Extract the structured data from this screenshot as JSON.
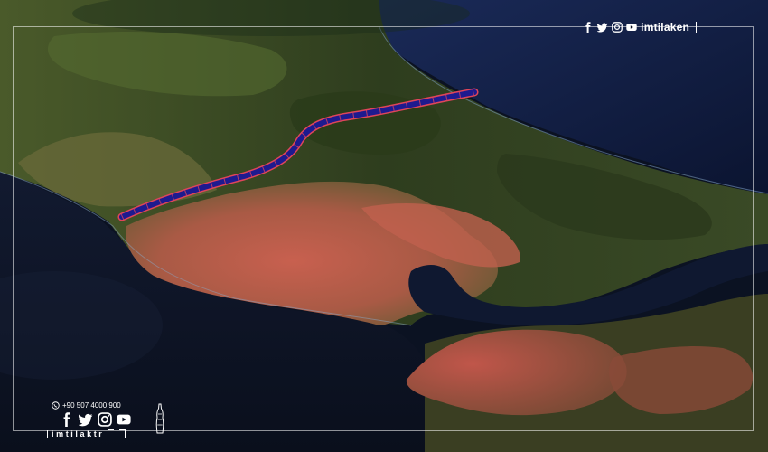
{
  "brand": {
    "top_handle": "imtilaken",
    "top_icons": [
      "facebook-icon",
      "twitter-icon",
      "instagram-icon",
      "youtube-icon"
    ],
    "phone": "+90 507 4000 900",
    "bottom_icons": [
      "facebook-icon",
      "twitter-icon",
      "instagram-icon",
      "youtube-icon"
    ],
    "wordmark": "imtilaktr",
    "color": "#ffffff"
  },
  "map": {
    "canal_color": "#1e1a8f",
    "canal_edge_color": "#e0455a",
    "sea_color": "#0d1a3a",
    "land_color": "#3d4a22",
    "urban_color": "#b5574a"
  }
}
